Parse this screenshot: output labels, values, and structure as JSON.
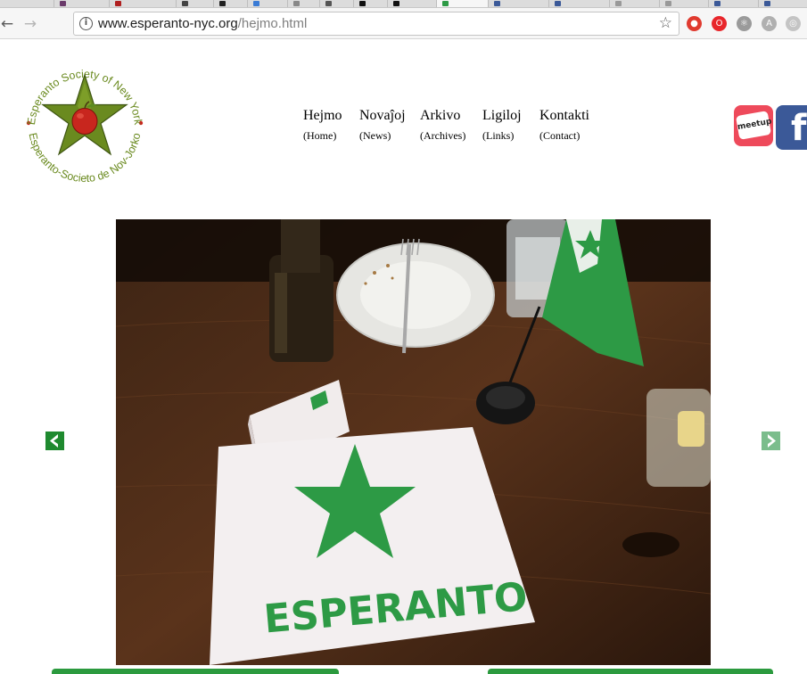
{
  "browser": {
    "url_host": "www.esperanto-nyc.org",
    "url_path": "/hejmo.html",
    "back_glyph": "←",
    "forward_glyph": "→",
    "info_glyph": "i",
    "star_glyph": "☆",
    "extensions": [
      {
        "name": "adblock-icon",
        "color": "#e03a2f",
        "glyph": "●"
      },
      {
        "name": "opera-icon",
        "color": "#e8262b",
        "glyph": "O"
      },
      {
        "name": "react-devtools-icon",
        "color": "#9a9a9a",
        "glyph": "⚛"
      },
      {
        "name": "angular-devtools-icon",
        "color": "#b0b0b0",
        "glyph": "A"
      },
      {
        "name": "extension-generic-icon",
        "color": "#c4c4c4",
        "glyph": "◎"
      }
    ]
  },
  "logo": {
    "ring_text_top": "Esperanto Society of New York",
    "ring_text_bottom": "Esperanto-Societo de Nov-Jorko",
    "star_color": "#6a8a1f",
    "apple_color": "#c8261e"
  },
  "nav": {
    "items": [
      {
        "label": "Hejmo",
        "sub": "(Home)"
      },
      {
        "label": "Novaĵoj",
        "sub": "(News)"
      },
      {
        "label": "Arkivo",
        "sub": "(Archives)"
      },
      {
        "label": "Ligiloj",
        "sub": "(Links)"
      },
      {
        "label": "Kontakti",
        "sub": "(Contact)"
      }
    ]
  },
  "social": {
    "meetup_label": "meetup",
    "facebook_label": "f"
  },
  "slideshow": {
    "caption_text": "ESPERANTO",
    "accent_color": "#2d9a45"
  }
}
